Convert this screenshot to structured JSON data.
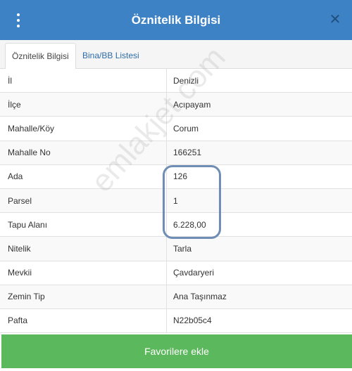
{
  "header": {
    "title": "Öznitelik Bilgisi",
    "menu_icon": "vertical-dots-icon",
    "close_icon": "close-icon"
  },
  "tabs": [
    {
      "label": "Öznitelik Bilgisi",
      "active": true
    },
    {
      "label": "Bina/BB Listesi",
      "active": false
    }
  ],
  "attributes": [
    {
      "key": "İl",
      "value": "Denizli"
    },
    {
      "key": "İlçe",
      "value": "Acıpayam"
    },
    {
      "key": "Mahalle/Köy",
      "value": "Corum"
    },
    {
      "key": "Mahalle No",
      "value": "166251"
    },
    {
      "key": "Ada",
      "value": "126"
    },
    {
      "key": "Parsel",
      "value": "1"
    },
    {
      "key": "Tapu Alanı",
      "value": "6.228,00"
    },
    {
      "key": "Nitelik",
      "value": "Tarla"
    },
    {
      "key": "Mevkii",
      "value": "Çavdaryeri"
    },
    {
      "key": "Zemin Tip",
      "value": "Ana Taşınmaz"
    },
    {
      "key": "Pafta",
      "value": "N22b05c4"
    }
  ],
  "watermark": "emlakjet.com",
  "footer": {
    "favorite_label": "Favorilere ekle"
  },
  "colors": {
    "header_bg": "#3e82c6",
    "button_bg": "#5cb85c",
    "tab_link": "#2d6ca8",
    "highlight_border": "#6f8db5"
  }
}
